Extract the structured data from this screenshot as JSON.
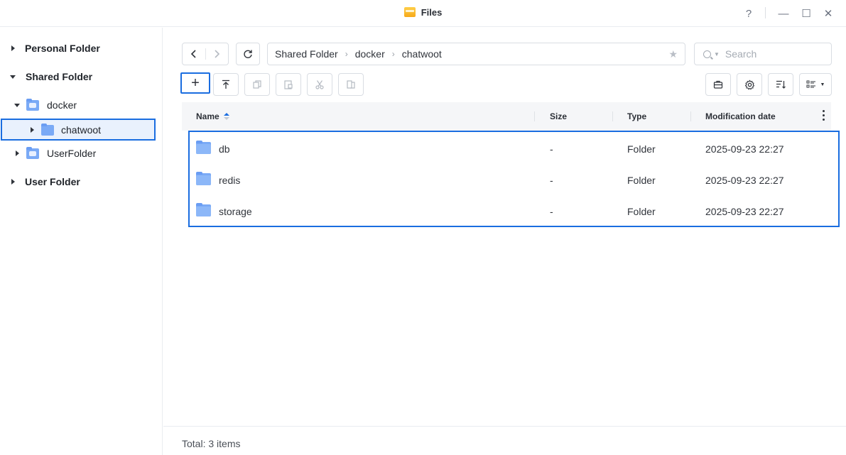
{
  "window": {
    "title": "Files",
    "help": "?",
    "minimize": "—",
    "maximize": "☐",
    "close": "✕"
  },
  "sidebar": {
    "personal_folder": "Personal Folder",
    "shared_folder": "Shared Folder",
    "docker": "docker",
    "chatwoot": "chatwoot",
    "user_folder_child": "UserFolder",
    "user_folder": "User Folder"
  },
  "toolbar": {
    "back": "‹",
    "forward": "›",
    "refresh": "↻",
    "new": "+",
    "upload": "upload-icon",
    "copy": "copy-icon",
    "paste": "paste-icon",
    "cut": "cut-icon",
    "move": "move-icon",
    "briefcase": "briefcase-icon",
    "settings": "gear-icon",
    "sort": "sort-icon",
    "view": "list-view-icon"
  },
  "breadcrumb": [
    "Shared Folder",
    "docker",
    "chatwoot"
  ],
  "breadcrumb_sep": "›",
  "search": {
    "placeholder": "Search"
  },
  "table": {
    "headers": {
      "name": "Name",
      "size": "Size",
      "type": "Type",
      "modified": "Modification date"
    },
    "rows": [
      {
        "name": "db",
        "size": "-",
        "type": "Folder",
        "modified": "2025-09-23 22:27"
      },
      {
        "name": "redis",
        "size": "-",
        "type": "Folder",
        "modified": "2025-09-23 22:27"
      },
      {
        "name": "storage",
        "size": "-",
        "type": "Folder",
        "modified": "2025-09-23 22:27"
      }
    ]
  },
  "footer": {
    "total": "Total: 3 items"
  },
  "colors": {
    "accent": "#1a6de0",
    "folder": "#7aaaf6"
  }
}
